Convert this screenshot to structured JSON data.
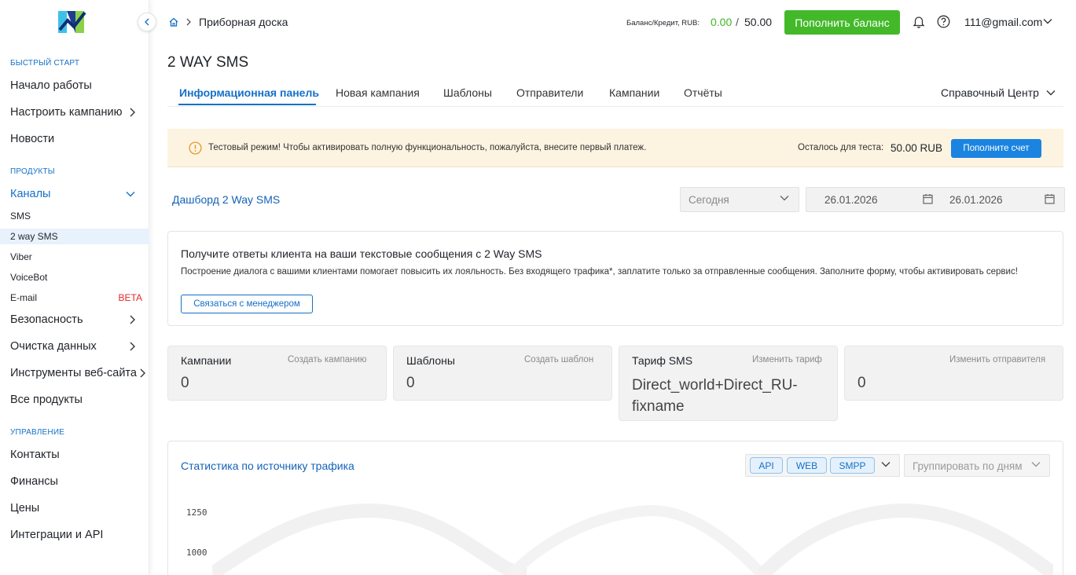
{
  "sidebar": {
    "sections": {
      "quick_start": "БЫСТРЫЙ СТАРТ",
      "products": "ПРОДУКТЫ",
      "management": "УПРАВЛЕНИЕ"
    },
    "items": {
      "getting_started": "Начало работы",
      "setup_campaign": "Настроить кампанию",
      "news": "Новости",
      "channels": "Каналы",
      "sms": "SMS",
      "two_way_sms": "2 way SMS",
      "viber": "Viber",
      "voicebot": "VoiceBot",
      "email": "E-mail",
      "email_badge": "BETA",
      "security": "Безопасность",
      "data_cleaning": "Очистка данных",
      "web_tools": "Инструменты веб-сайта",
      "all_products": "Все продукты",
      "contacts": "Контакты",
      "finance": "Финансы",
      "prices": "Цены",
      "integrations": "Интеграции и API"
    }
  },
  "header": {
    "breadcrumb": "Приборная доска",
    "balance_label": "Баланс/Кредит, RUB:",
    "balance_value": "0.00",
    "balance_slash": "/",
    "balance_limit": "50.00",
    "topup_label": "Пополнить баланс",
    "user_email": "111@gmail.com"
  },
  "page": {
    "title": "2 WAY SMS"
  },
  "tabs": {
    "info_panel": "Информационная панель",
    "new_campaign": "Новая кампания",
    "templates": "Шаблоны",
    "senders": "Отправители",
    "campaigns": "Кампании",
    "reports": "Отчёты",
    "help_center": "Справочный Центр"
  },
  "banner": {
    "text": "Тестовый режим! Чтобы активировать полную функциональность, пожалуйста, внесите первый платеж.",
    "remaining_label": "Осталось для теста:",
    "remaining_amount": "50.00 RUB",
    "button": "Пополните счет"
  },
  "dashboard": {
    "title": "Дашборд 2 Way SMS",
    "period": "Сегодня",
    "date_from": "26.01.2026",
    "date_to": "26.01.2026"
  },
  "promo": {
    "title": "Получите ответы клиента на ваши текстовые сообщения с 2 Way SMS",
    "description": "Построение диалога с вашими клиентами помогает повысить их лояльность. Без входящего трафика*, заплатите только за отправленные сообщения. Заполните форму, чтобы активировать сервис!",
    "button": "Связаться с менеджером"
  },
  "stats": {
    "campaigns": {
      "label": "Кампании",
      "link": "Создать кампанию",
      "value": "0"
    },
    "templates": {
      "label": "Шаблоны",
      "link": "Создать шаблон",
      "value": "0"
    },
    "tariff": {
      "label": "Тариф SMS",
      "link": "Изменить тариф",
      "value": "Direct_world+Direct_RU-fixname"
    },
    "sender": {
      "link": "Изменить отправителя",
      "value": "0"
    }
  },
  "traffic": {
    "title": "Статистика по источнику трафика",
    "sources": [
      "API",
      "WEB",
      "SMPP"
    ],
    "group_by": "Группировать по дням",
    "y_ticks": [
      "1250",
      "1000"
    ]
  },
  "colors": {
    "accent": "#1570c8",
    "success": "#43b92a",
    "warning_bg": "#fdf3e1",
    "beta": "#e0262b"
  }
}
